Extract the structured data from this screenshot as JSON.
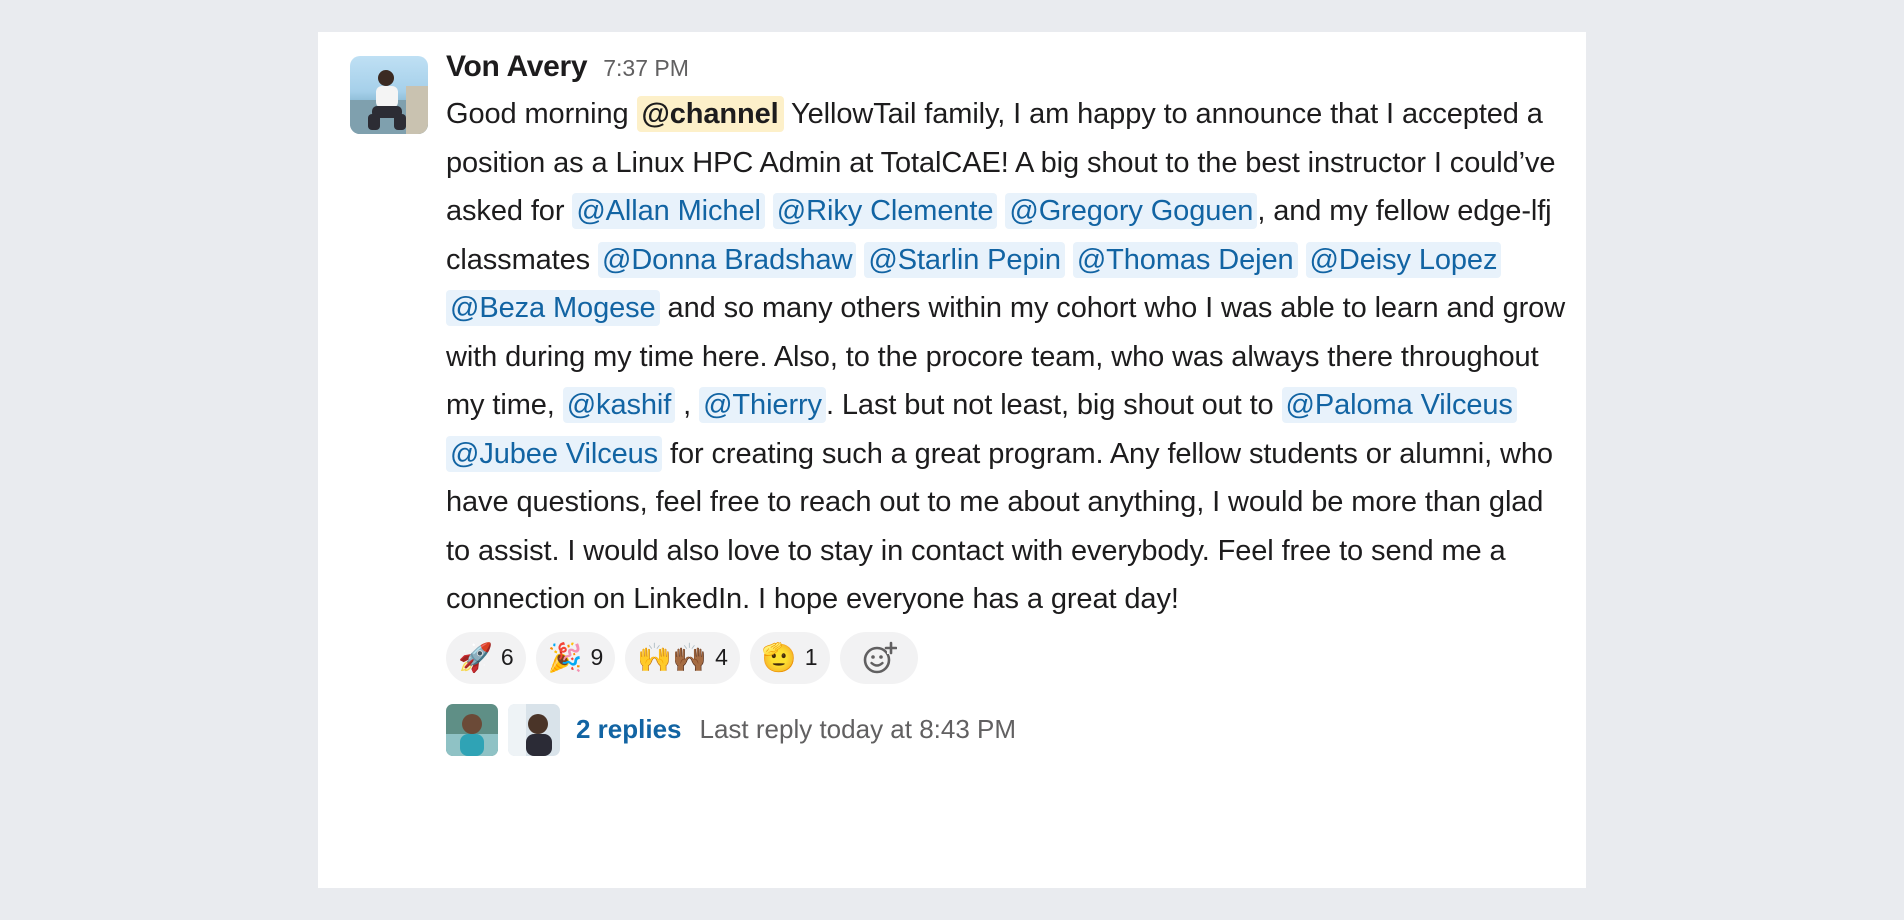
{
  "message": {
    "author": "Von Avery",
    "timestamp": "7:37 PM",
    "text": {
      "t1": "Good morning ",
      "channel": "@channel",
      "t2": " YellowTail family, I am happy to announce that I accepted a position as a Linux HPC Admin at TotalCAE! A big shout to the best instructor I could’ve asked for ",
      "m_allan": "@Allan Michel",
      "m_riky": "@Riky Clemente",
      "m_gregory": "@Gregory Goguen",
      "t3": ", and my fellow edge-lfj classmates ",
      "m_donna": "@Donna Bradshaw",
      "m_starlin": "@Starlin Pepin",
      "m_thomas": "@Thomas Dejen",
      "m_deisy": "@Deisy Lopez",
      "m_beza": "@Beza Mogese",
      "t4": " and so many others within my cohort who I was able to learn and grow with during my time here. Also, to the procore team, who was always there throughout my time, ",
      "m_kashif": "@kashif",
      "t5": " , ",
      "m_thierry": "@Thierry",
      "t6": ". Last but not least, big shout out to ",
      "m_paloma": "@Paloma Vilceus",
      "m_jubee": "@Jubee Vilceus",
      "t7": " for creating such a great program. Any fellow students or alumni, who have questions, feel free to reach out to me about anything, I would be more than glad to assist. I would also love to stay in contact with everybody. Feel free to send me a connection on LinkedIn. I hope everyone has a great day!"
    }
  },
  "reactions": [
    {
      "icon": "rocket-icon",
      "emoji": "🚀",
      "count": "6"
    },
    {
      "icon": "party-popper-icon",
      "emoji": "🎉",
      "count": "9"
    },
    {
      "icon": "raised-hands-icon",
      "emoji": "🙌🙌🏾",
      "count": "4"
    },
    {
      "icon": "salute-icon",
      "emoji": "🫡",
      "count": "1"
    }
  ],
  "thread": {
    "replies": "2 replies",
    "last_reply": "Last reply today at 8:43 PM"
  }
}
